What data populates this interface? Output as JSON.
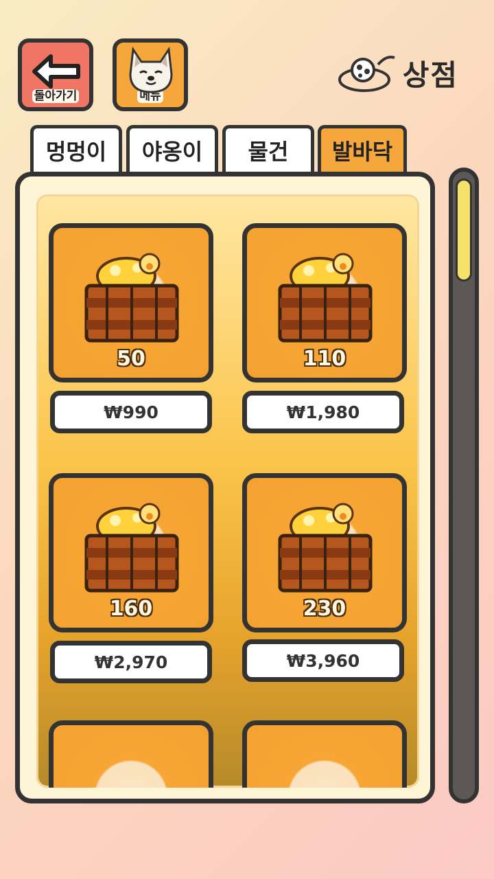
{
  "header": {
    "back_label": "돌아가기",
    "menu_label": "메뉴",
    "shop_title": "상점"
  },
  "tabs": [
    {
      "label": "멍멍이",
      "active": false
    },
    {
      "label": "야옹이",
      "active": false
    },
    {
      "label": "물건",
      "active": false
    },
    {
      "label": "발바닥",
      "active": true
    }
  ],
  "items": [
    {
      "amount": "50",
      "price": "₩990"
    },
    {
      "amount": "110",
      "price": "₩1,980"
    },
    {
      "amount": "160",
      "price": "₩2,970"
    },
    {
      "amount": "230",
      "price": "₩3,960"
    }
  ],
  "colors": {
    "accent": "#f5a73c",
    "back_button": "#f07565",
    "scroll_thumb": "#f6e26a"
  },
  "icons": [
    "back-arrow-icon",
    "dog-face-icon",
    "shop-bowl-icon",
    "paw-chest-icon"
  ]
}
